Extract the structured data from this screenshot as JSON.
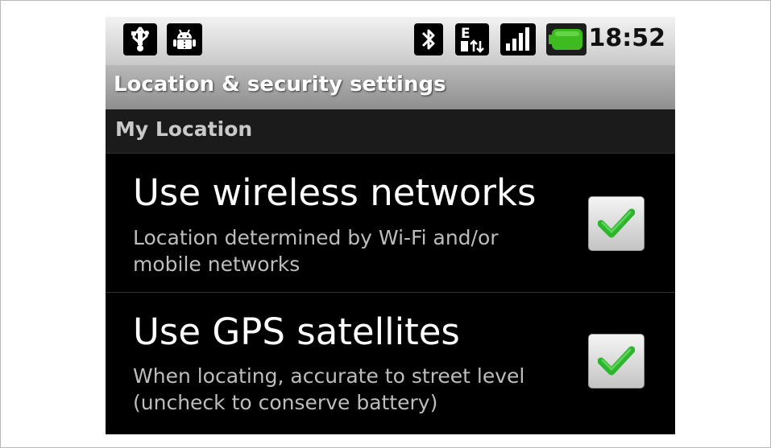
{
  "status_bar": {
    "time": "18:52",
    "icons": [
      "usb-icon",
      "android-debug-icon",
      "bluetooth-icon",
      "edge-data-icon",
      "signal-icon",
      "battery-icon"
    ]
  },
  "title_bar": {
    "title": "Location & security settings"
  },
  "section": {
    "label": "My Location"
  },
  "preferences": [
    {
      "title": "Use wireless networks",
      "summary_line1": "Location determined by Wi-Fi and/or",
      "summary_line2": "mobile networks",
      "checked": true
    },
    {
      "title": "Use GPS satellites",
      "summary_line1": "When locating, accurate to street level",
      "summary_line2": "(uncheck to conserve battery)",
      "checked": true
    }
  ],
  "colors": {
    "check": "#2db52d",
    "battery": "#3dbb1f",
    "background": "#000000",
    "title_bar": "#a0a0a0"
  }
}
